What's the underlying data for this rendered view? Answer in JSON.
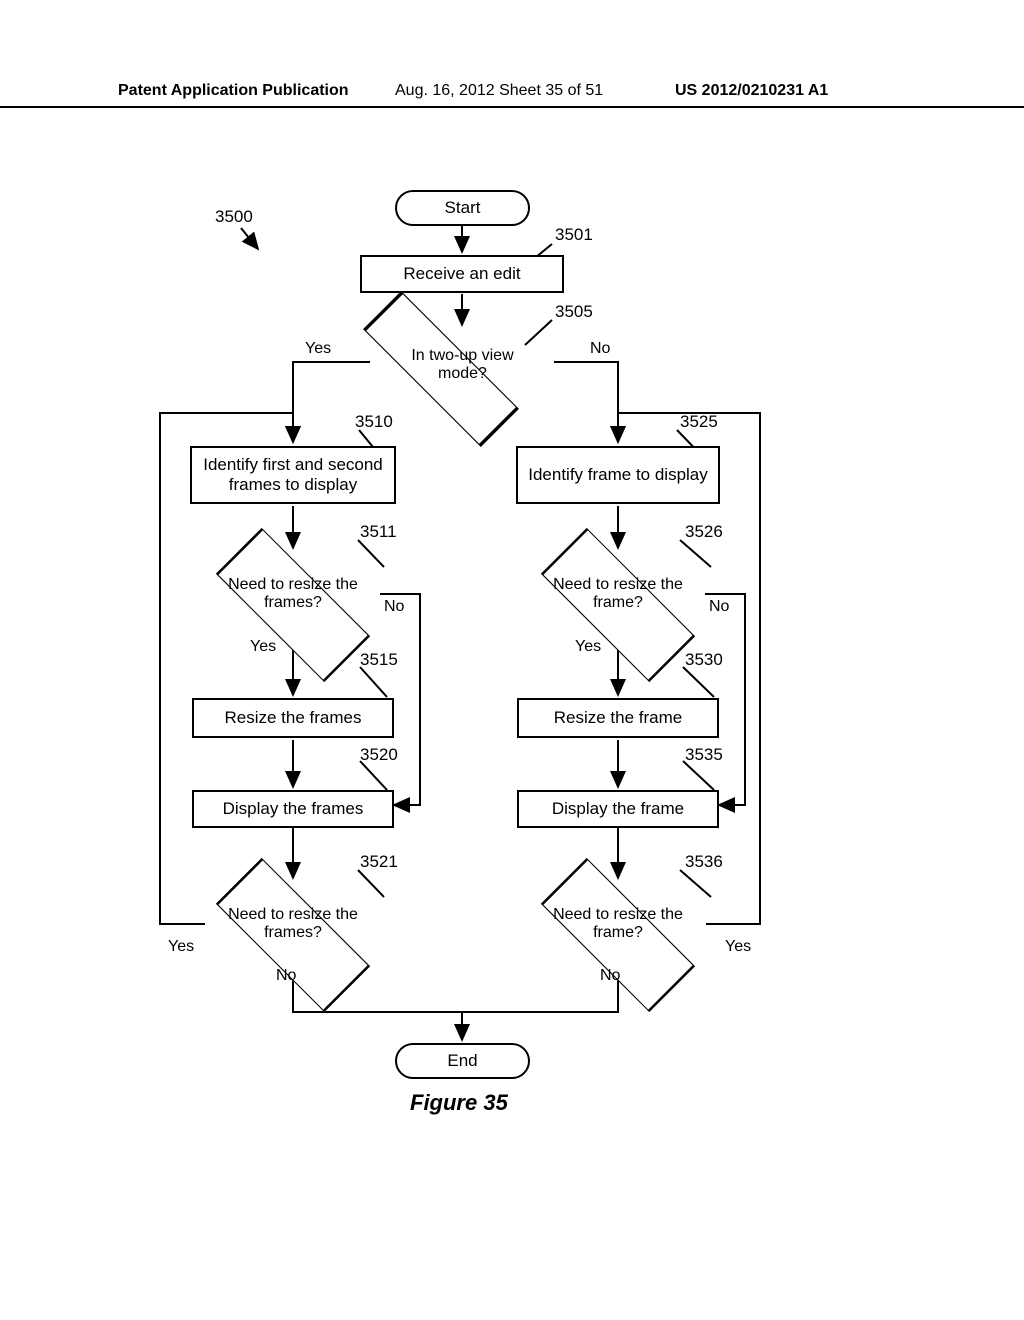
{
  "header": {
    "left": "Patent Application Publication",
    "mid": "Aug. 16, 2012  Sheet 35 of 51",
    "right": "US 2012/0210231 A1"
  },
  "refs": {
    "r3500": "3500",
    "r3501": "3501",
    "r3505": "3505",
    "r3510": "3510",
    "r3511": "3511",
    "r3515": "3515",
    "r3520": "3520",
    "r3521": "3521",
    "r3525": "3525",
    "r3526": "3526",
    "r3530": "3530",
    "r3535": "3535",
    "r3536": "3536"
  },
  "nodes": {
    "start": "Start",
    "receive_edit": "Receive an edit",
    "two_up": "In two-up view mode?",
    "identify_two": "Identify first and second frames to display",
    "identify_one": "Identify frame to display",
    "need_resize_frames_1": "Need to resize the frames?",
    "need_resize_frame_1": "Need to resize the frame?",
    "resize_frames": "Resize the frames",
    "resize_frame": "Resize the frame",
    "display_frames": "Display the frames",
    "display_frame": "Display the frame",
    "need_resize_frames_2": "Need to resize the frames?",
    "need_resize_frame_2": "Need to resize the frame?",
    "end": "End"
  },
  "labels": {
    "yes": "Yes",
    "no": "No"
  },
  "caption": "Figure 35"
}
